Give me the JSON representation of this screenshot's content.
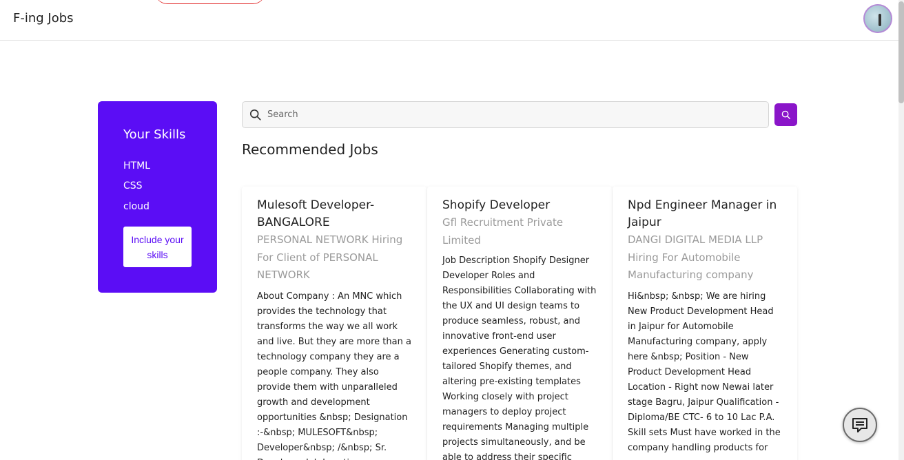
{
  "header": {
    "brand": "F-ing Jobs",
    "avatar_icon": "user-avatar"
  },
  "skills": {
    "title": "Your Skills",
    "items": [
      "HTML",
      "CSS",
      "cloud"
    ],
    "include_button": "Include your skills"
  },
  "search": {
    "placeholder": "Search",
    "value": "",
    "button_icon": "search-icon"
  },
  "recommended": {
    "title": "Recommended Jobs",
    "jobs": [
      {
        "title": "Mulesoft Developer-BANGALORE",
        "company": "PERSONAL NETWORK Hiring For Client of PERSONAL NETWORK",
        "description": "About Company : An MNC which provides the technology that transforms the way we all work and live. But they are more than a technology company they are a people company. They also provide them with unparalleled growth and development opportunities &nbsp; Designation :-&nbsp; MULESOFT&nbsp; Developer&nbsp; /&nbsp; Sr. Developer Job Location"
      },
      {
        "title": "Shopify Developer",
        "company": "Gfl Recruitment Private Limited",
        "description": "Job Description Shopify Designer Developer Roles and Responsibilities Collaborating with the UX and UI design teams to produce seamless, robust, and innovative front-end user experiences Generating custom-tailored Shopify themes, and altering pre-existing templates Working closely with project managers to deploy project requirements Managing multiple projects simultaneously, and be able to address their specific"
      },
      {
        "title": "Npd Engineer Manager in Jaipur",
        "company": "DANGI DIGITAL MEDIA LLP Hiring For Automobile Manufacturing company",
        "description": "Hi&nbsp; &nbsp; We are hiring New Product Development Head in Jaipur for Automobile Manufacturing company, apply here &nbsp; Position - New Product Development Head Location - Right now Newai later stage Bagru, Jaipur Qualification - Diploma/BE CTC- 6 to 10 Lac P.A. Skill sets Must have worked in the company handling products for"
      }
    ]
  },
  "chat": {
    "icon": "chat-icon"
  },
  "colors": {
    "skills_bg": "#5b0df5",
    "search_button": "#8a15c9",
    "company_text": "#9a9a9a"
  }
}
